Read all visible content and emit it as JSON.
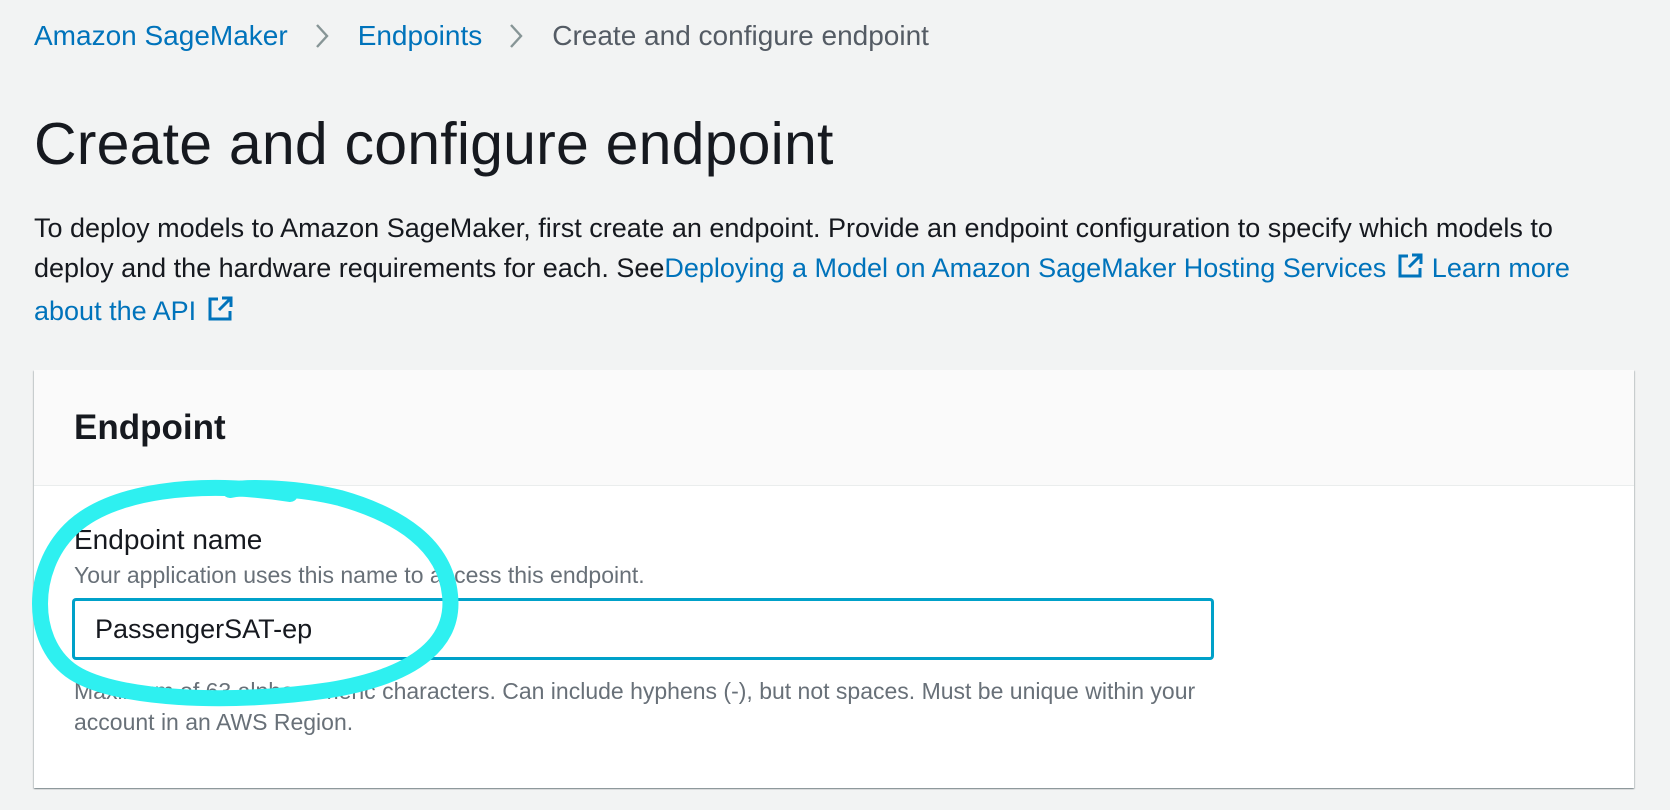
{
  "breadcrumb": {
    "items": [
      "Amazon SageMaker",
      "Endpoints"
    ],
    "current": "Create and configure endpoint"
  },
  "page": {
    "title": "Create and configure endpoint",
    "description_prefix": "To deploy models to Amazon SageMaker, first create an endpoint. Provide an endpoint configuration to specify which models to deploy and the hardware requirements for each.  See",
    "link_hosting": "Deploying a Model on Amazon SageMaker Hosting Services",
    "link_api": "Learn more about the API"
  },
  "panel": {
    "title": "Endpoint",
    "field_label": "Endpoint name",
    "field_description": "Your application uses this name to access this endpoint.",
    "field_value": "PassengerSAT-ep",
    "constraint": "Maximum of 63 alphanumeric characters. Can include hyphens (-), but not spaces. Must be unique within your account in an AWS Region."
  },
  "icons": {
    "breadcrumb_separator": "chevron-right-icon",
    "external_link": "external-link-icon"
  },
  "colors": {
    "link": "#0073bb",
    "focus_border": "#00a1c9",
    "annotation": "#2ef0f0",
    "background": "#f2f3f3"
  }
}
